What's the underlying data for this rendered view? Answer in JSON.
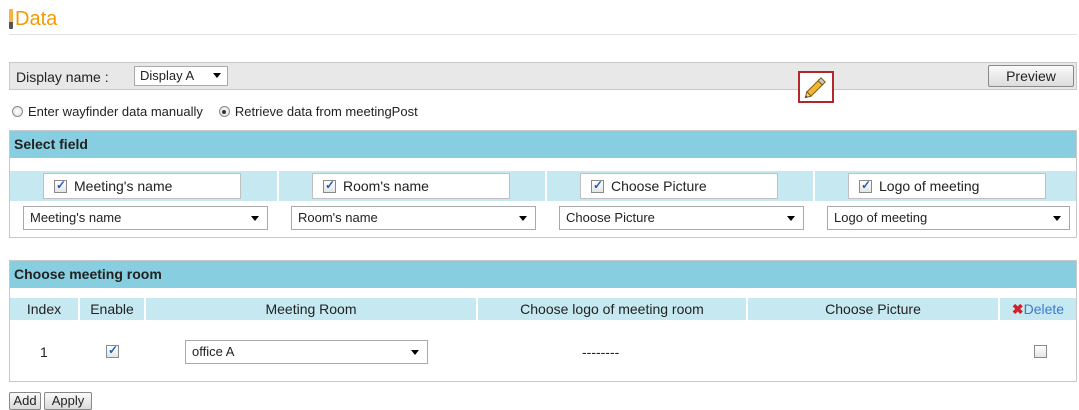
{
  "page": {
    "title": "Data"
  },
  "display": {
    "label": "Display name :",
    "selected": "Display A",
    "preview_label": "Preview"
  },
  "source": {
    "options": [
      {
        "label": "Enter wayfinder data manually",
        "checked": false
      },
      {
        "label": "Retrieve data from meetingPost",
        "checked": true
      }
    ]
  },
  "select_field": {
    "header": "Select field",
    "fields": [
      {
        "label": "Meeting's name",
        "checked": true,
        "selected": "Meeting's name"
      },
      {
        "label": "Room's name",
        "checked": true,
        "selected": "Room's name"
      },
      {
        "label": "Choose Picture",
        "checked": true,
        "selected": "Choose Picture"
      },
      {
        "label": "Logo of meeting",
        "checked": true,
        "selected": "Logo of meeting"
      }
    ]
  },
  "meeting_room": {
    "header": "Choose meeting room",
    "columns": {
      "index": "Index",
      "enable": "Enable",
      "room": "Meeting Room",
      "logo": "Choose logo of meeting room",
      "picture": "Choose Picture",
      "delete": "Delete"
    },
    "rows": [
      {
        "index": "1",
        "enabled": true,
        "room": "office A",
        "logo": "--------",
        "delete_checked": false
      }
    ]
  },
  "actions": {
    "add": "Add",
    "apply": "Apply"
  },
  "icons": {
    "edit": "pencil-icon",
    "delete": "x-icon"
  },
  "colors": {
    "title": "#f59a00",
    "header": "#87cfe0",
    "subheader": "#c6e8f1",
    "delete": "#d21f2a",
    "highlight": "#b0282b"
  }
}
